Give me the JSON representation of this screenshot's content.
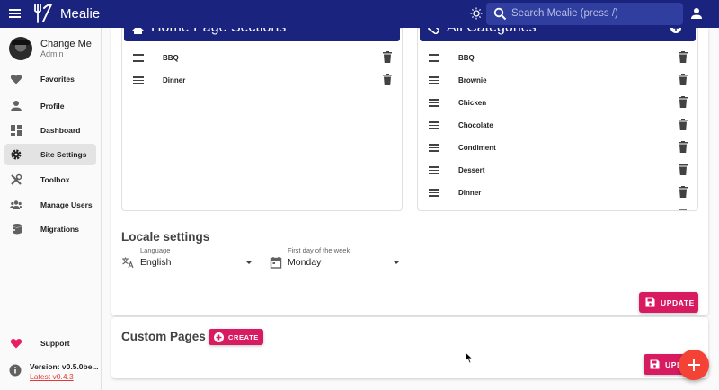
{
  "app": {
    "title": "Mealie",
    "search_placeholder": "Search Mealie (press /)"
  },
  "user": {
    "name": "Change Me",
    "role": "Admin"
  },
  "sidebar": {
    "items": [
      {
        "label": "Favorites",
        "icon": "heart-icon"
      },
      {
        "label": "Profile",
        "icon": "person-icon"
      },
      {
        "label": "Dashboard",
        "icon": "dashboard-icon"
      },
      {
        "label": "Site Settings",
        "icon": "gear-icon",
        "active": true
      },
      {
        "label": "Toolbox",
        "icon": "tools-icon"
      },
      {
        "label": "Manage Users",
        "icon": "group-icon"
      },
      {
        "label": "Migrations",
        "icon": "database-import-icon"
      },
      {
        "label": "Support",
        "icon": "heart-icon"
      }
    ],
    "version": "Version: v0.5.0be...",
    "latest": "Latest v0.4.3"
  },
  "home_sections": {
    "title": "Home Page Sections",
    "items": [
      "BBQ",
      "Dinner"
    ]
  },
  "categories": {
    "title": "All Categories",
    "items": [
      "BBQ",
      "Brownie",
      "Chicken",
      "Chocolate",
      "Condiment",
      "Dessert",
      "Dinner"
    ]
  },
  "locale": {
    "title": "Locale settings",
    "language_label": "Language",
    "language_value": "English",
    "first_day_label": "First day of the week",
    "first_day_value": "Monday",
    "update_label": "UPDATE"
  },
  "custom_pages": {
    "title": "Custom Pages",
    "create_label": "CREATE",
    "update_label": "UPDATE"
  },
  "colors": {
    "primary": "#1a237e",
    "accent": "#d81b60",
    "fab": "#f44336"
  }
}
